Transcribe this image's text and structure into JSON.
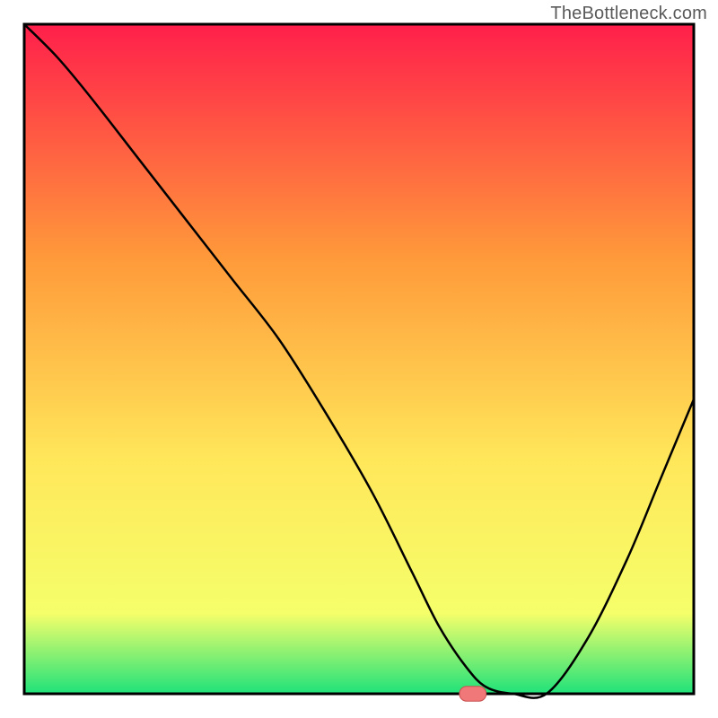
{
  "watermark": "TheBottleneck.com",
  "colors": {
    "gradient_top": "#ff1f4b",
    "gradient_upper_mid": "#ff9a3a",
    "gradient_mid": "#ffe75a",
    "gradient_lower_mid": "#f5ff6a",
    "gradient_bottom": "#1fe27a",
    "border": "#000000",
    "curve": "#000000",
    "marker_fill": "#f07878",
    "marker_stroke": "#c85050"
  },
  "chart_data": {
    "type": "line",
    "title": "",
    "xlabel": "",
    "ylabel": "",
    "xlim": [
      0,
      100
    ],
    "ylim": [
      0,
      100
    ],
    "series": [
      {
        "name": "bottleneck-curve",
        "x": [
          0,
          5,
          10,
          17,
          24,
          31,
          38,
          45,
          52,
          58,
          62,
          66,
          69,
          73,
          78,
          84,
          90,
          95,
          100
        ],
        "y": [
          100,
          95,
          89,
          80,
          71,
          62,
          53,
          42,
          30,
          18,
          10,
          4,
          1,
          0,
          0,
          8,
          20,
          32,
          44
        ]
      }
    ],
    "marker": {
      "x": 67,
      "y": 0,
      "width": 4,
      "height": 2.2
    }
  }
}
